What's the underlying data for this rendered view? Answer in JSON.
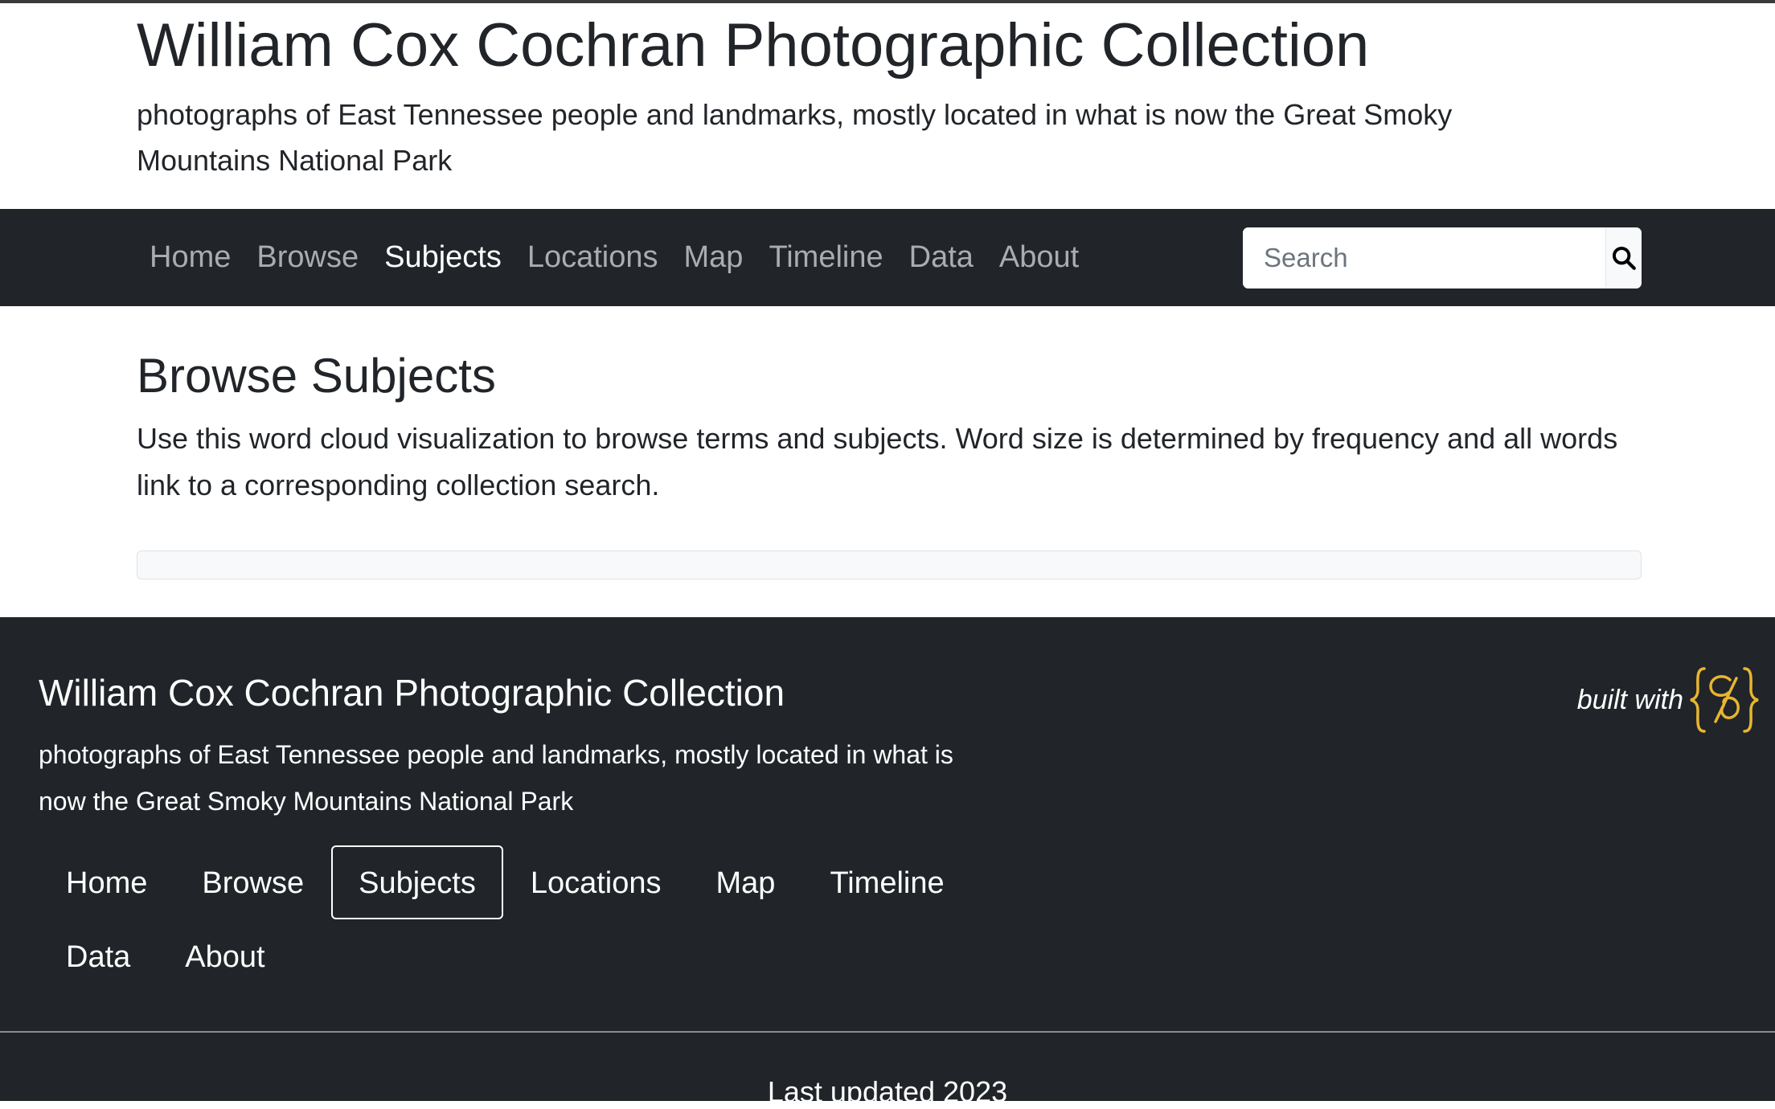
{
  "header": {
    "title": "William Cox Cochran Photographic Collection",
    "tagline": "photographs of East Tennessee people and landmarks, mostly located in what is now the Great Smoky Mountains National Park"
  },
  "nav": {
    "items": [
      {
        "label": "Home",
        "active": false
      },
      {
        "label": "Browse",
        "active": false
      },
      {
        "label": "Subjects",
        "active": true
      },
      {
        "label": "Locations",
        "active": false
      },
      {
        "label": "Map",
        "active": false
      },
      {
        "label": "Timeline",
        "active": false
      },
      {
        "label": "Data",
        "active": false
      },
      {
        "label": "About",
        "active": false
      }
    ],
    "search": {
      "placeholder": "Search",
      "icon": "search-icon"
    }
  },
  "main": {
    "title": "Browse Subjects",
    "intro": "Use this word cloud visualization to browse terms and subjects. Word size is determined by frequency and all words link to a corresponding collection search."
  },
  "footer": {
    "title": "William Cox Cochran Photographic Collection",
    "tagline": "photographs of East Tennessee people and landmarks, mostly located in what is now the Great Smoky Mountains National Park",
    "built_with": "built with",
    "built_with_logo": "collectionbuilder-logo-icon",
    "updated": "Last updated 2023"
  },
  "colors": {
    "navbar_bg": "#212529",
    "nav_inactive": "#a9adb1",
    "logo_gold": "#e8b530"
  }
}
